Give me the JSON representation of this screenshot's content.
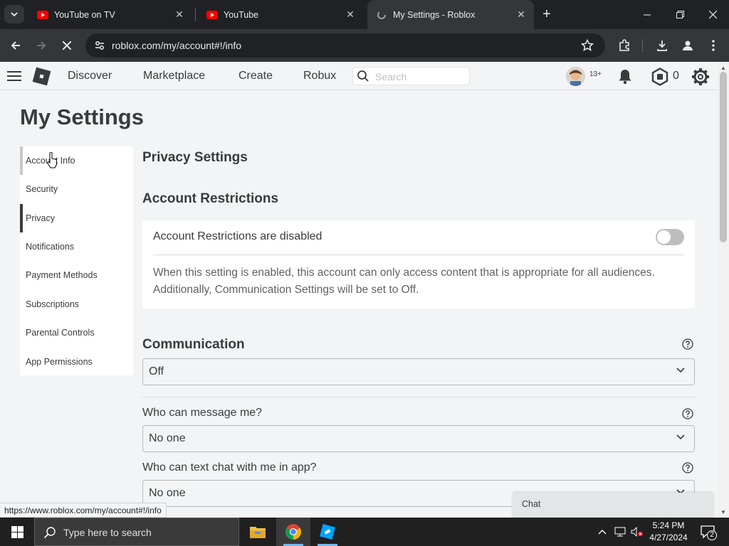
{
  "browser": {
    "tabs": [
      {
        "title": "YouTube on TV",
        "favicon": "youtube-icon"
      },
      {
        "title": "YouTube",
        "favicon": "youtube-icon"
      },
      {
        "title": "My Settings - Roblox",
        "favicon": "loading-icon"
      }
    ],
    "url": "roblox.com/my/account#!/info",
    "status_url": "https://www.roblox.com/my/account#!/info"
  },
  "header": {
    "nav": [
      "Discover",
      "Marketplace",
      "Create",
      "Robux"
    ],
    "search_placeholder": "Search",
    "age_badge": "13+",
    "robux_balance": "0"
  },
  "page": {
    "title": "My Settings",
    "menu": [
      {
        "label": "Account Info",
        "state": "hover"
      },
      {
        "label": "Security",
        "state": ""
      },
      {
        "label": "Privacy",
        "state": "active"
      },
      {
        "label": "Notifications",
        "state": ""
      },
      {
        "label": "Payment Methods",
        "state": ""
      },
      {
        "label": "Subscriptions",
        "state": ""
      },
      {
        "label": "Parental Controls",
        "state": ""
      },
      {
        "label": "App Permissions",
        "state": ""
      }
    ]
  },
  "privacy": {
    "heading": "Privacy Settings",
    "restrictions_heading": "Account Restrictions",
    "restrictions_label": "Account Restrictions are disabled",
    "restrictions_enabled": false,
    "restrictions_desc": "When this setting is enabled, this account can only access content that is appropriate for all audiences. Additionally, Communication Settings will be set to Off.",
    "communication_heading": "Communication",
    "communication_value": "Off",
    "message_label": "Who can message me?",
    "message_value": "No one",
    "textchat_label": "Who can text chat with me in app?",
    "textchat_value": "No one"
  },
  "chat": {
    "label": "Chat"
  },
  "taskbar": {
    "search_placeholder": "Type here to search",
    "time": "5:24 PM",
    "date": "4/27/2024",
    "notification_count": "2"
  },
  "colors": {
    "page_bg": "#f2f4f5",
    "text": "#393b3d",
    "toggle_off": "#bdbebe",
    "youtube_red": "#ff0000"
  }
}
